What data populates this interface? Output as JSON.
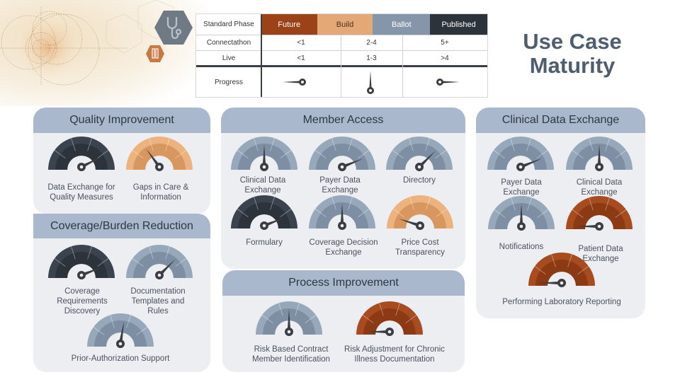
{
  "title": "Use Case Maturity",
  "colors": {
    "future": "#9b4218",
    "build": "#e3a875",
    "ballot": "#8596ab",
    "published": "#2c333b",
    "panel_header": "#a9b8cc",
    "panel_body": "#eceef2",
    "needle": "#3a3d42"
  },
  "icons": [
    "stethoscope-icon",
    "lab-tube-icon"
  ],
  "legend": {
    "header_label": "Standard Phase",
    "phases": [
      "Future",
      "Build",
      "Ballot",
      "Published"
    ],
    "rows": [
      {
        "label": "Connectathon",
        "values": [
          "<1",
          "2-4",
          "5+"
        ]
      },
      {
        "label": "Live",
        "values": [
          "<1",
          "1-3",
          ">4"
        ]
      }
    ],
    "progress_label": "Progress",
    "progress_needles": [
      "left",
      "up",
      "right"
    ]
  },
  "panels": {
    "quality": {
      "title": "Quality Improvement",
      "gauges": [
        {
          "label": "Data Exchange for\nQuality Measures",
          "phase": "published",
          "progress": 0.85
        },
        {
          "label": "Gaps in Care &\nInformation",
          "phase": "build",
          "progress": 0.3
        }
      ]
    },
    "coverage": {
      "title": "Coverage/Burden Reduction",
      "gauges": [
        {
          "label": "Coverage\nRequirements\nDiscovery",
          "phase": "published",
          "progress": 0.88
        },
        {
          "label": "Documentation\nTemplates and\nRules",
          "phase": "ballot",
          "progress": 0.75
        },
        {
          "label": "Prior-Authorization Support",
          "phase": "ballot",
          "progress": 0.55
        }
      ]
    },
    "member": {
      "title": "Member Access",
      "gauges": [
        {
          "label": "Clinical Data\nExchange",
          "phase": "ballot",
          "progress": 0.5
        },
        {
          "label": "Payer Data\nExchange",
          "phase": "ballot",
          "progress": 0.88
        },
        {
          "label": "Directory",
          "phase": "ballot",
          "progress": 0.75
        },
        {
          "label": "Formulary",
          "phase": "published",
          "progress": 0.88
        },
        {
          "label": "Coverage Decision\nExchange",
          "phase": "ballot",
          "progress": 0.5
        },
        {
          "label": "Price Cost\nTransparency",
          "phase": "build",
          "progress": 0.1
        }
      ]
    },
    "process": {
      "title": "Process Improvement",
      "gauges": [
        {
          "label": "Risk Based Contract\nMember Identification",
          "phase": "ballot",
          "progress": 0.5
        },
        {
          "label": "Risk Adjustment for Chronic\nIllness Documentation",
          "phase": "future",
          "progress": 0.0
        }
      ]
    },
    "clinical": {
      "title": "Clinical Data Exchange",
      "gauges": [
        {
          "label": "Payer Data\nExchange",
          "phase": "ballot",
          "progress": 0.88
        },
        {
          "label": "Clinical Data\nExchange",
          "phase": "ballot",
          "progress": 0.5
        },
        {
          "label": "Notifications",
          "phase": "ballot",
          "progress": 0.5
        },
        {
          "label": "Patient Data\nExchange",
          "phase": "future",
          "progress": 0.0
        },
        {
          "label": "Performing Laboratory Reporting",
          "phase": "future",
          "progress": 0.0
        }
      ]
    }
  }
}
